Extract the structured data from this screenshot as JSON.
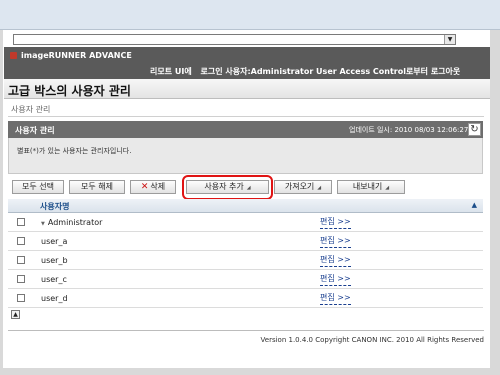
{
  "address_bar": {
    "value": "",
    "dropdown_icon": "chevron-down-icon"
  },
  "header": {
    "brand": "imageRUNNER ADVANCE",
    "links": [
      "리모트 UI에",
      "로그인 사용자:Administrator User Access Control로부터 로그아웃"
    ]
  },
  "page_title": "고급 박스의 사용자 관리",
  "breadcrumb": "사용자 관리",
  "panel": {
    "title": "사용자 관리",
    "updated": "업데이트 일시: 2010 08/03 12:06:27",
    "refresh_icon": "refresh-icon",
    "note": "별표(*)가 있는 사용자는 관리자입니다."
  },
  "toolbar": {
    "select_all": "모두 선택",
    "deselect_all": "모두 해제",
    "delete": "삭제",
    "add_user": "사용자 추가",
    "import": "가져오기",
    "export": "내보내기"
  },
  "table": {
    "header_name": "사용자명",
    "rows": [
      {
        "name": "Administrator",
        "edit": "편집 >>",
        "admin": true
      },
      {
        "name": "user_a",
        "edit": "편집 >>"
      },
      {
        "name": "user_b",
        "edit": "편집 >>"
      },
      {
        "name": "user_c",
        "edit": "편집 >>"
      },
      {
        "name": "user_d",
        "edit": "편집 >>"
      }
    ]
  },
  "footer": "Version 1.0.4.0 Copyright CANON INC. 2010 All Rights Reserved",
  "colors": {
    "highlight": "#e01414",
    "header": "#5a5a5a",
    "link": "#1a3f8f"
  }
}
